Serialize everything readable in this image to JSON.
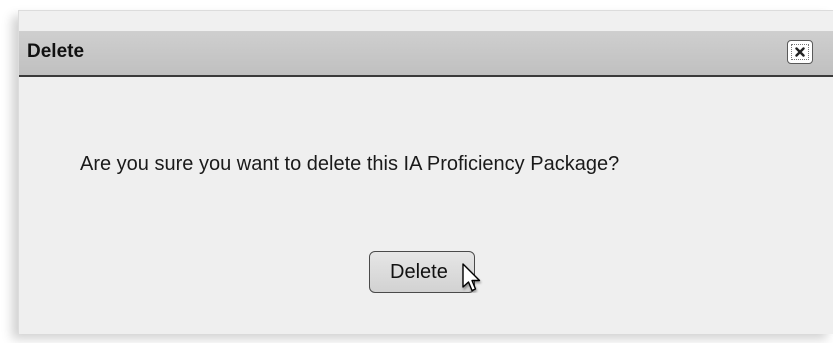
{
  "dialog": {
    "title": "Delete",
    "close_icon": "close-icon",
    "message": "Are you sure you want to delete this IA Proficiency Package?",
    "delete_label": "Delete"
  },
  "colors": {
    "titlebar": "#c6c6c6",
    "body": "#efefef",
    "border": "#3a3a3a"
  },
  "cursor_icon": "mouse-pointer-icon"
}
